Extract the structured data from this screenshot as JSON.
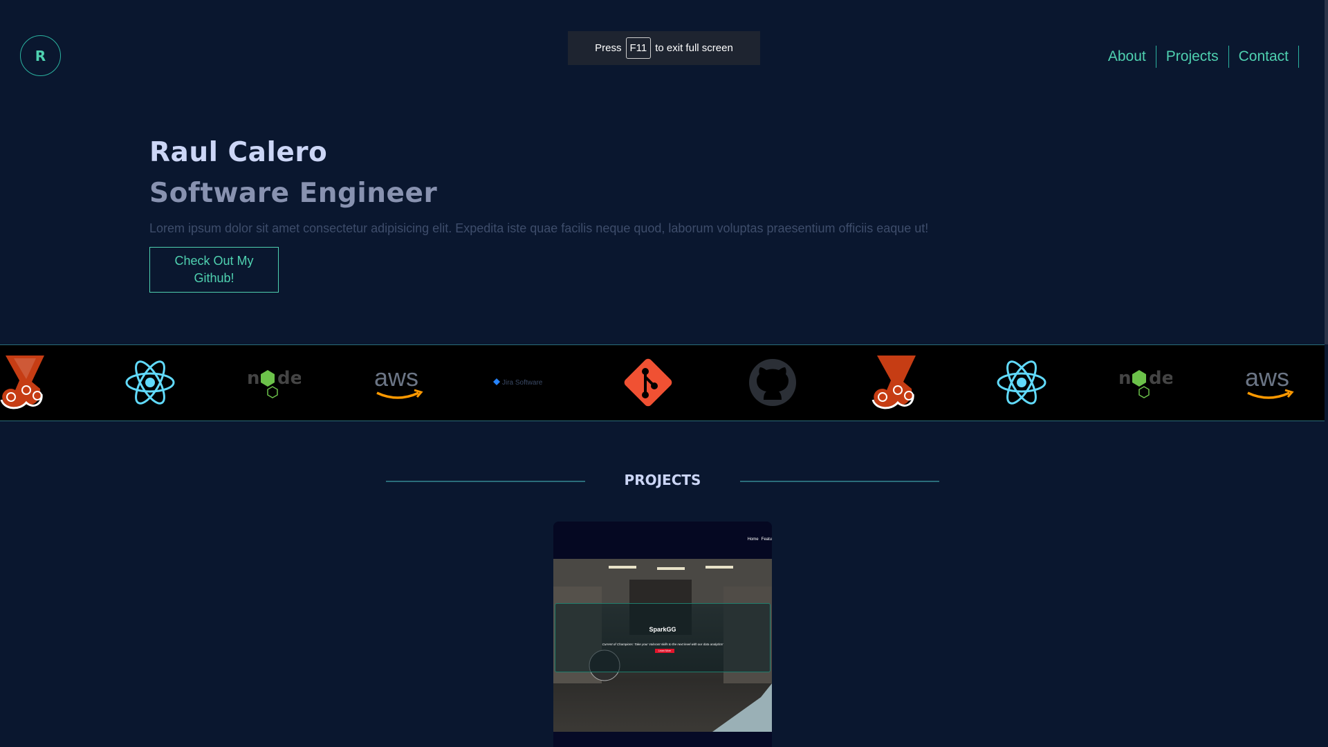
{
  "header": {
    "logo_letter": "R",
    "nav": [
      {
        "label": "About"
      },
      {
        "label": "Projects"
      },
      {
        "label": "Contact"
      }
    ]
  },
  "fullscreen_toast": {
    "prefix": "Press",
    "key": "F11",
    "suffix": "to exit full screen"
  },
  "hero": {
    "name": "Raul Calero",
    "role": "Software Engineer",
    "description": "Lorem ipsum dolor sit amet consectetur adipisicing elit. Expedita iste quae facilis neque quod, laborum voluptas praesentium officiis eaque ut!",
    "cta_label": "Check Out My Github!"
  },
  "tech_strip": {
    "items": [
      "jest-icon",
      "react-icon",
      "nodejs-icon",
      "aws-icon",
      "jira-icon",
      "git-icon",
      "github-icon",
      "jest-icon",
      "react-icon",
      "nodejs-icon",
      "aws-icon"
    ],
    "jira_label": "Jira Software",
    "aws_label": "aws",
    "node_label": "node"
  },
  "projects": {
    "heading": "PROJECTS",
    "card": {
      "nav": [
        "Home",
        "Featu"
      ],
      "title": "SparkGG",
      "subtitle": "Current of Champions: Take your Valorant skills to the next level with our data analytics!",
      "button": "Learn More"
    }
  },
  "colors": {
    "background": "#0a172f",
    "accent": "#4fd1b0",
    "heading": "#ccd6f6",
    "muted": "#8892b0"
  }
}
